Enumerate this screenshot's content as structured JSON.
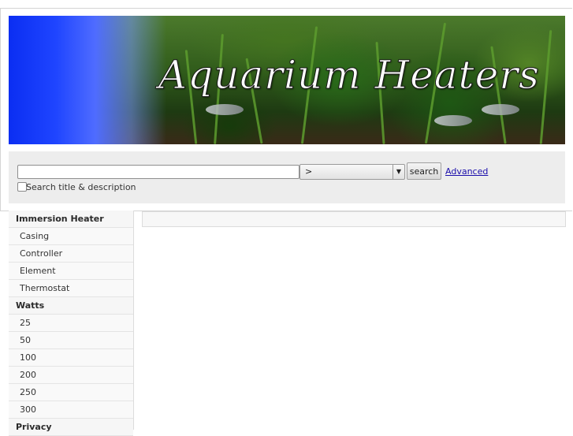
{
  "header": {
    "banner_title": "Aquarium Heaters"
  },
  "search": {
    "input_value": "",
    "category_selected": ">",
    "search_label": "search",
    "advanced_label": "Advanced",
    "checkbox_label": "Search title & description",
    "checkbox_checked": false
  },
  "sidebar": {
    "sections": [
      {
        "heading": "Immersion Heater",
        "items": [
          "Casing",
          "Controller",
          "Element",
          "Thermostat"
        ]
      },
      {
        "heading": "Watts",
        "items": [
          "25",
          "50",
          "100",
          "200",
          "250",
          "300"
        ]
      },
      {
        "heading": "Privacy",
        "items": []
      }
    ]
  },
  "colors": {
    "banner_blue": "#1f45ff",
    "link": "#1a0dab",
    "search_panel": "#ededed"
  }
}
